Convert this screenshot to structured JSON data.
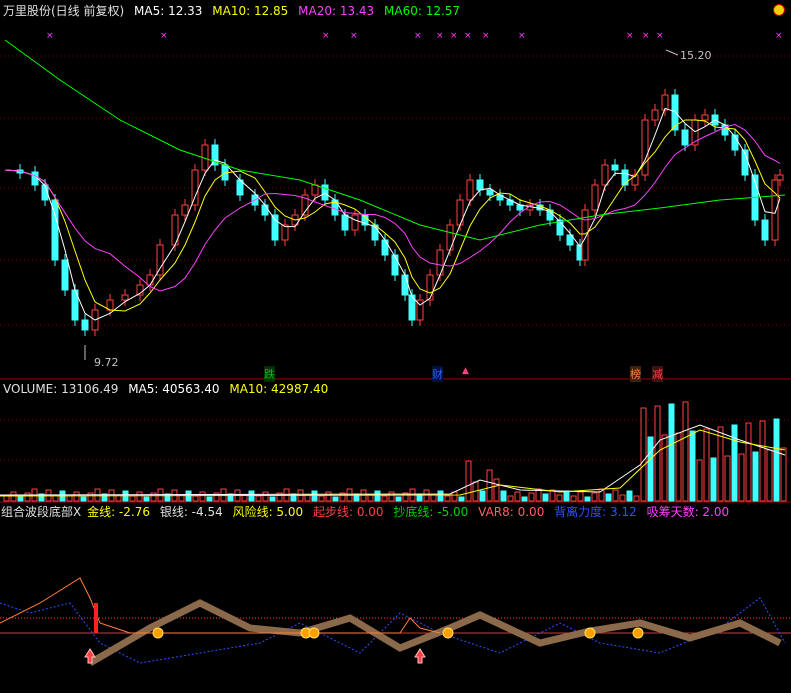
{
  "main": {
    "stock_name": "万里股份(日线 前复权)",
    "ma5": "MA5: 12.33",
    "ma10": "MA10: 12.85",
    "ma20": "MA20: 13.43",
    "ma60": "MA60: 12.57",
    "high_label": "15.20",
    "low_label": "9.72",
    "markers": [
      {
        "text": "跌",
        "color": "#00c000"
      },
      {
        "text": "财",
        "color": "#3060ff"
      },
      {
        "text": "▲",
        "color": "#ff4080"
      },
      {
        "text": "榜",
        "color": "#ff8040"
      },
      {
        "text": "减",
        "color": "#ff4040"
      }
    ],
    "colors": {
      "ma5": "#ffffff",
      "ma10": "#ffff00",
      "ma20": "#ff40ff",
      "ma60": "#00ff00",
      "up": "#ff4040",
      "down": "#40ffff"
    }
  },
  "volume": {
    "title": "VOLUME: 13106.49",
    "ma5": "MA5: 40563.40",
    "ma10": "MA10: 42987.40"
  },
  "indicator": {
    "title": "组合波段底部X",
    "gold": "金线: -2.76",
    "silver": "银线: -4.54",
    "risk": "风险线: 5.00",
    "start": "起步线: 0.00",
    "bottom": "抄底线: -5.00",
    "var8": "VAR8: 0.00",
    "weaken": "背离力度: 3.12",
    "chip": "吸筹天数: 2.00"
  }
}
